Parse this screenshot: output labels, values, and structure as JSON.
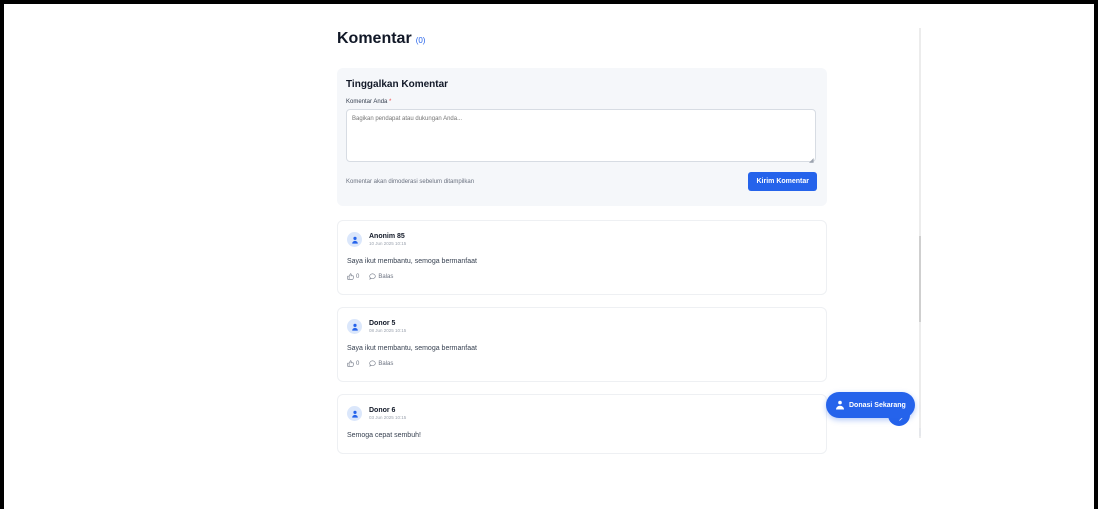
{
  "comments_section": {
    "title": "Komentar",
    "count": "(0)"
  },
  "form": {
    "title": "Tinggalkan Komentar",
    "label": "Komentar Anda",
    "required_mark": "*",
    "placeholder": "Bagikan pendapat atau dukungan Anda...",
    "note": "Komentar akan dimoderasi sebelum ditampilkan",
    "submit_label": "Kirim Komentar"
  },
  "comments": [
    {
      "author": "Anonim 85",
      "date": "10 Jun 2025 10:15",
      "text": "Saya ikut membantu, semoga bermanfaat",
      "likes": "0",
      "reply_label": "Balas"
    },
    {
      "author": "Donor 5",
      "date": "08 Jun 2025 10:15",
      "text": "Saya ikut membantu, semoga bermanfaat",
      "likes": "0",
      "reply_label": "Balas"
    },
    {
      "author": "Donor 6",
      "date": "03 Jun 2025 10:15",
      "text": "Semoga cepat sembuh!",
      "likes": "0",
      "reply_label": "Balas"
    }
  ],
  "donate_button": {
    "label": "Donasi Sekarang"
  },
  "colors": {
    "accent": "#2563eb",
    "required": "#ef4444"
  },
  "icons": [
    "user-icon",
    "thumbs-up-icon",
    "comment-icon",
    "hand-heart-icon",
    "arrow-icon",
    "resize-icon"
  ]
}
